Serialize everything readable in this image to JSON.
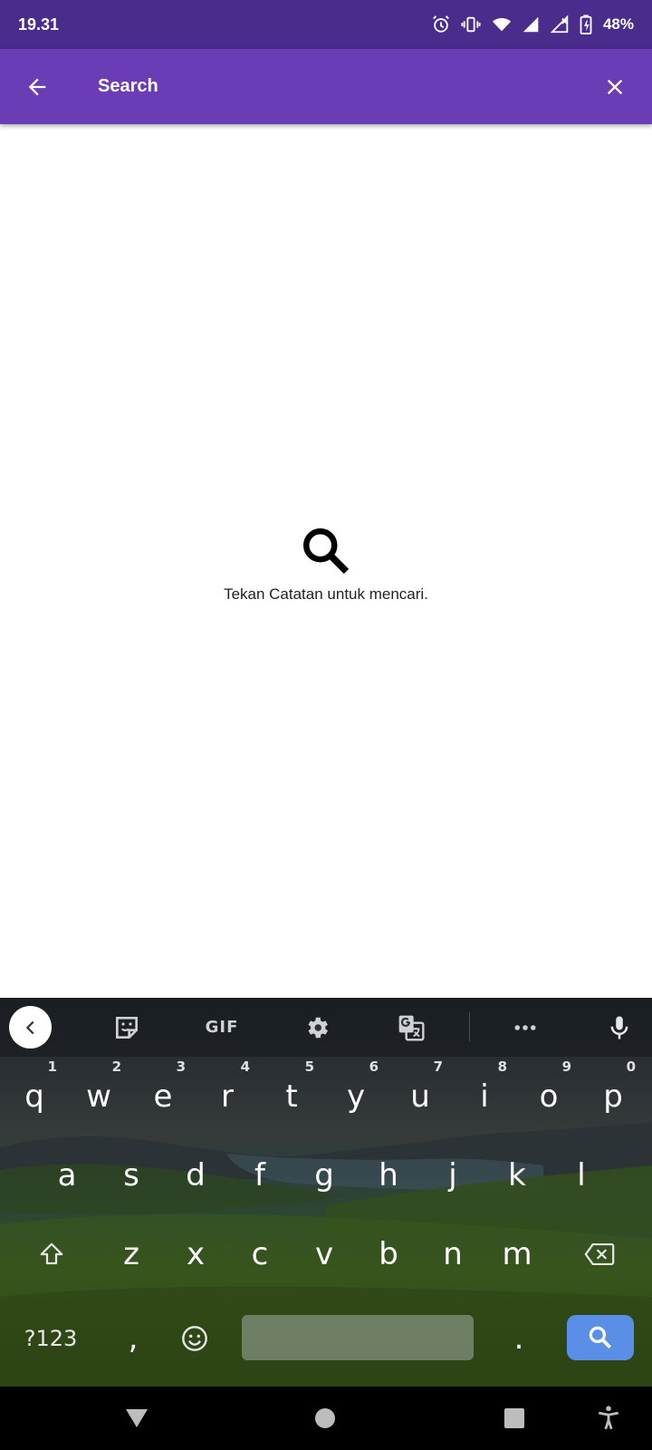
{
  "status_bar": {
    "time": "19.31",
    "battery": "48%"
  },
  "app_bar": {
    "title": "Search"
  },
  "empty_state": {
    "message": "Tekan Catatan untuk mencari."
  },
  "keyboard": {
    "toolbar": {
      "gif_label": "GIF"
    },
    "row1": [
      {
        "key": "q",
        "hint": "1"
      },
      {
        "key": "w",
        "hint": "2"
      },
      {
        "key": "e",
        "hint": "3"
      },
      {
        "key": "r",
        "hint": "4"
      },
      {
        "key": "t",
        "hint": "5"
      },
      {
        "key": "y",
        "hint": "6"
      },
      {
        "key": "u",
        "hint": "7"
      },
      {
        "key": "i",
        "hint": "8"
      },
      {
        "key": "o",
        "hint": "9"
      },
      {
        "key": "p",
        "hint": "0"
      }
    ],
    "row2": [
      "a",
      "s",
      "d",
      "f",
      "g",
      "h",
      "j",
      "k",
      "l"
    ],
    "row3": [
      "z",
      "x",
      "c",
      "v",
      "b",
      "n",
      "m"
    ],
    "symbols_label": "?123",
    "comma": ",",
    "period": "."
  },
  "icons": {
    "back": "arrow-left-icon",
    "close": "close-icon",
    "search": "search-icon"
  },
  "colors": {
    "status_bar": "#4a2c8c",
    "app_bar": "#6a3cb5",
    "enter_key": "#5b8ee6"
  }
}
